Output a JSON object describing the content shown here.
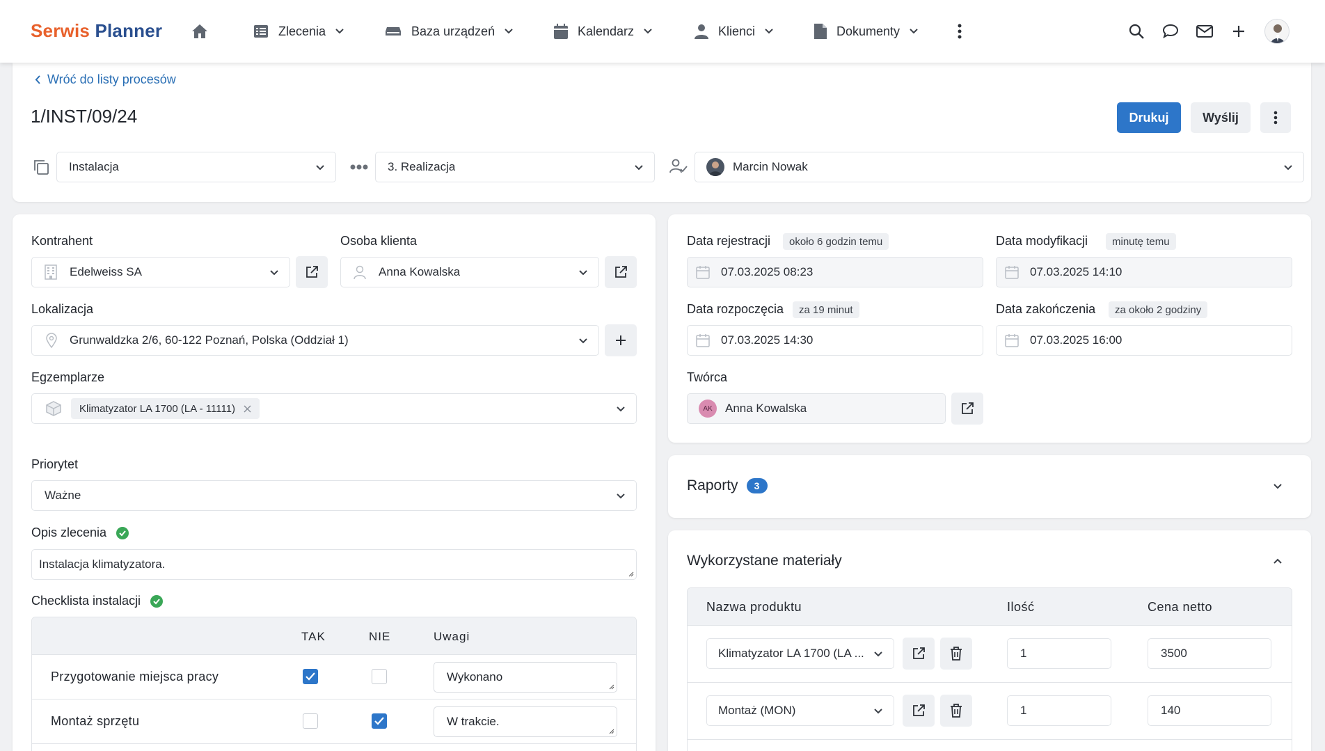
{
  "header": {
    "logo_part1": "Serwis",
    "logo_part2": "Planner",
    "nav": [
      "Zlecenia",
      "Baza urządzeń",
      "Kalendarz",
      "Klienci",
      "Dokumenty"
    ]
  },
  "page": {
    "back_link": "Wróć do listy procesów",
    "title": "1/INST/09/24",
    "print_button": "Drukuj",
    "send_button": "Wyślij",
    "process_type": "Instalacja",
    "process_stage": "3. Realizacja",
    "assignee": "Marcin Nowak"
  },
  "left": {
    "contractor_label": "Kontrahent",
    "contractor_value": "Edelweiss SA",
    "client_person_label": "Osoba klienta",
    "client_person_value": "Anna Kowalska",
    "location_label": "Lokalizacja",
    "location_value": "Grunwaldzka 2/6, 60-122 Poznań, Polska (Oddział 1)",
    "units_label": "Egzemplarze",
    "unit_tag": "Klimatyzator LA 1700 (LA - 11111)",
    "priority_label": "Priorytet",
    "priority_value": "Ważne",
    "description_label": "Opis zlecenia",
    "description_value": "Instalacja klimatyzatora.",
    "checklist_label": "Checklista instalacji",
    "checklist_headers": [
      "TAK",
      "NIE",
      "Uwagi"
    ],
    "checklist_rows": [
      {
        "name": "Przygotowanie miejsca pracy",
        "tak": true,
        "nie": false,
        "note": "Wykonano"
      },
      {
        "name": "Montaż sprzętu",
        "tak": false,
        "nie": true,
        "note": "W trakcie."
      }
    ]
  },
  "right": {
    "reg_label": "Data rejestracji",
    "reg_badge": "około 6 godzin temu",
    "reg_value": "07.03.2025 08:23",
    "mod_label": "Data modyfikacji",
    "mod_badge": "minutę temu",
    "mod_value": "07.03.2025 14:10",
    "start_label": "Data rozpoczęcia",
    "start_badge": "za 19 minut",
    "start_value": "07.03.2025 14:30",
    "end_label": "Data zakończenia",
    "end_badge": "za około 2 godziny",
    "end_value": "07.03.2025 16:00",
    "creator_label": "Twórca",
    "creator_initials": "AK",
    "creator_value": "Anna Kowalska",
    "reports_label": "Raporty",
    "reports_count": "3",
    "materials_label": "Wykorzystane materiały",
    "materials_headers": [
      "Nazwa produktu",
      "Ilość",
      "Cena netto"
    ],
    "materials_rows": [
      {
        "product": "Klimatyzator LA 1700 (LA ...",
        "qty": "1",
        "price": "3500"
      },
      {
        "product": "Montaż (MON)",
        "qty": "1",
        "price": "140"
      }
    ]
  },
  "colors": {
    "accent": "#2d76c9",
    "logo_orange": "#e8612c",
    "logo_blue": "#2a4f8f",
    "success": "#3aa757"
  }
}
